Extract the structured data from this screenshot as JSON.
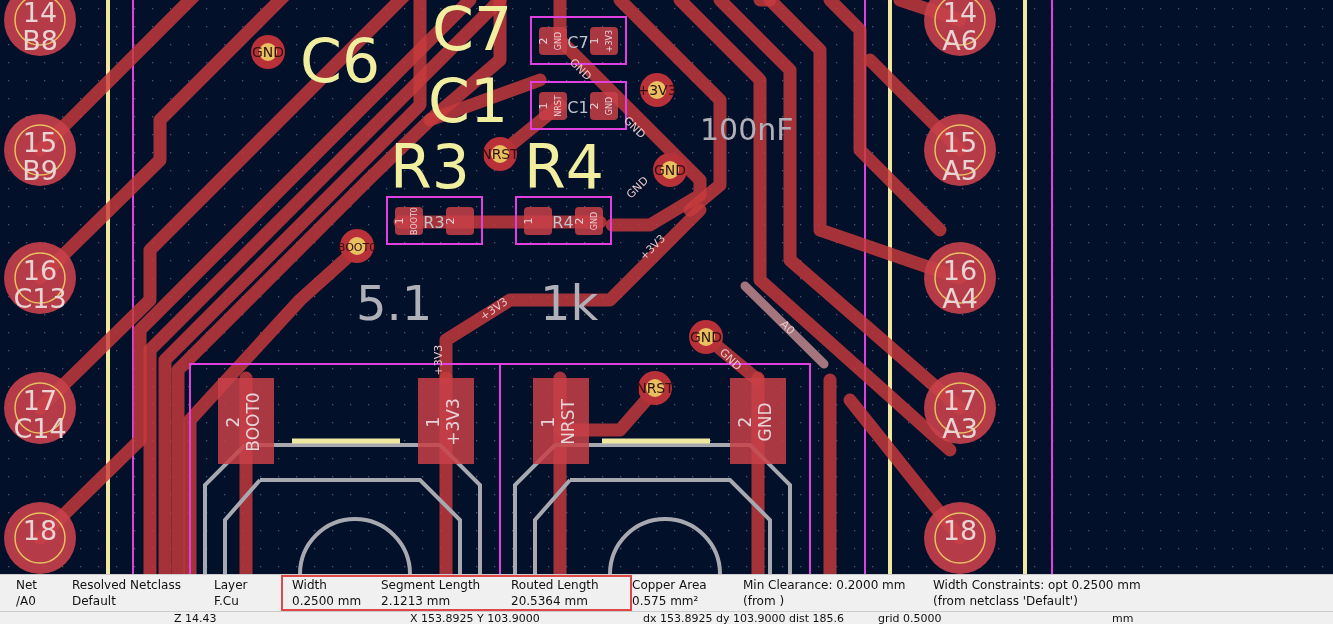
{
  "pcb": {
    "pins_left": [
      {
        "number": "14",
        "name": "B8"
      },
      {
        "number": "15",
        "name": "B9"
      },
      {
        "number": "16",
        "name": "C13"
      },
      {
        "number": "17",
        "name": "C14"
      },
      {
        "number": "18"
      }
    ],
    "pins_right": [
      {
        "number": "14",
        "name": "A6"
      },
      {
        "number": "15",
        "name": "A5"
      },
      {
        "number": "16",
        "name": "A4"
      },
      {
        "number": "17",
        "name": "A3"
      },
      {
        "number": "18"
      }
    ],
    "silk_refs": [
      "C6",
      "C7",
      "C1",
      "R3",
      "R4"
    ],
    "values": [
      "100nF",
      "5.1",
      "1k"
    ],
    "smd_parts": [
      {
        "ref": "C7",
        "pads": [
          {
            "number": "2",
            "net": "GND"
          },
          {
            "number": "1",
            "net": "+3V3"
          }
        ]
      },
      {
        "ref": "C1",
        "pads": [
          {
            "number": "1",
            "net": "NRST"
          },
          {
            "number": "2",
            "net": "GND"
          }
        ]
      },
      {
        "ref": "R3",
        "pads": [
          {
            "number": "1",
            "net": "BOOT0"
          },
          {
            "number": "2"
          }
        ]
      },
      {
        "ref": "R4",
        "pads": [
          {
            "number": "1"
          },
          {
            "number": "2",
            "net": "GND"
          }
        ]
      }
    ],
    "vias": [
      {
        "net": "GND"
      },
      {
        "net": "+3V3"
      },
      {
        "net": "NRST"
      },
      {
        "net": "GND"
      },
      {
        "net": "BOOT0"
      },
      {
        "net": "GND"
      },
      {
        "net": "NRST"
      }
    ],
    "track_labels": [
      "GND",
      "GND",
      "GND",
      "+3V3",
      "+3V3",
      "+3V3",
      "GND",
      "A0"
    ],
    "switch_pads": [
      {
        "number": "2",
        "net": "BOOT0"
      },
      {
        "number": "1",
        "net": "+3V3"
      },
      {
        "number": "1",
        "net": "NRST"
      },
      {
        "number": "2",
        "net": "GND"
      }
    ]
  },
  "properties": [
    {
      "label": "Net",
      "value": "/A0",
      "highlighted": false
    },
    {
      "label": "Resolved Netclass",
      "value": "Default",
      "highlighted": false
    },
    {
      "label": "Layer",
      "value": "F.Cu",
      "highlighted": false
    },
    {
      "label": "Width",
      "value": "0.2500 mm",
      "highlighted": true
    },
    {
      "label": "Segment Length",
      "value": "2.1213 mm",
      "highlighted": true
    },
    {
      "label": "Routed Length",
      "value": "20.5364 mm",
      "highlighted": true
    },
    {
      "label": "Copper Area",
      "value": "0.575 mm²",
      "highlighted": false
    },
    {
      "label": "Min Clearance: 0.2000 mm",
      "value": "(from )",
      "highlighted": false
    },
    {
      "label": "Width Constraints: opt 0.2500 mm",
      "value": "(from netclass 'Default')",
      "highlighted": false
    }
  ],
  "status_bar": {
    "zoom": "Z 14.43",
    "cursor": "X 153.8925  Y 103.9000",
    "delta": "dx 153.8925  dy 103.9000  dist 185.6",
    "grid": "grid 0.5000",
    "units": "mm"
  }
}
